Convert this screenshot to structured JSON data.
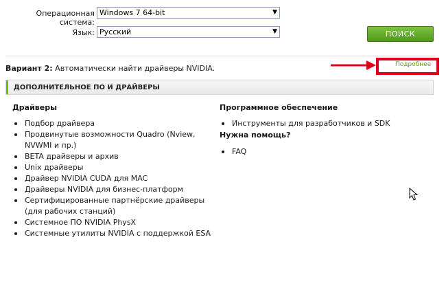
{
  "os_selector": {
    "label": "Операционная система:",
    "value": "Windows 7 64-bit"
  },
  "lang_selector": {
    "label": "Язык:",
    "value": "Русский"
  },
  "search_button": {
    "label": "ПОИСК"
  },
  "variant": {
    "prefix": "Вариант 2:",
    "text": "Автоматически найти драйверы NVIDIA."
  },
  "details_link": {
    "label": "Подробнее"
  },
  "section": {
    "title": "ДОПОЛНИТЕЛЬНОЕ ПО И ДРАЙВЕРЫ"
  },
  "drivers": {
    "heading": "Драйверы",
    "items": [
      "Подбор драйвера",
      "Продвинутые возможности Quadro (Nview, NVWMI и пр.)",
      "BETA драйверы и архив",
      "Unix драйверы",
      "Драйвер NVIDIA CUDA для MAC",
      "Драйверы NVIDIA для бизнес-платформ",
      "Сертифицированные партнёрские драйверы (для рабочих станций)",
      "Системное ПО NVIDIA PhysX",
      "Системные утилиты NVIDIA с поддержкой ESA"
    ]
  },
  "software": {
    "heading": "Программное обеспечение",
    "items": [
      "Инструменты для разработчиков и SDK"
    ]
  },
  "help": {
    "heading": "Нужна помощь?",
    "items": [
      "FAQ"
    ]
  },
  "colors": {
    "accent_green": "#76b900",
    "highlight_red": "#e0001a"
  }
}
